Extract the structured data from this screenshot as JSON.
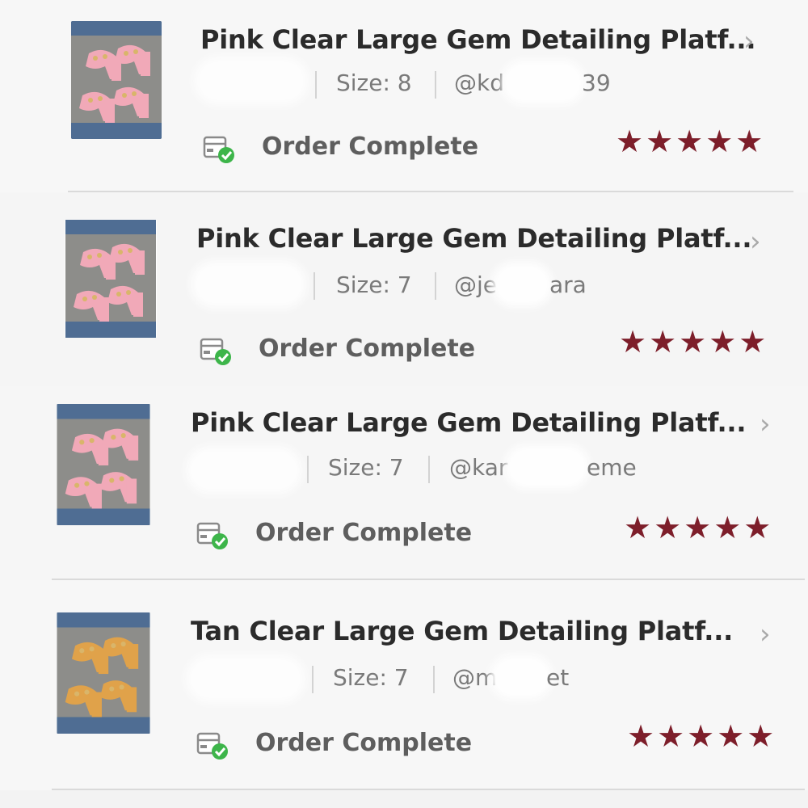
{
  "colors": {
    "star": "#7d1e2a",
    "check": "#3db54a",
    "title_text": "#2b2b2b",
    "meta_text": "#7a7a7a",
    "chevron": "#a9a9a9"
  },
  "orders": [
    {
      "title": "Pink Clear Large Gem Detailing Platf...",
      "size": "Size: 8",
      "user": "@kd",
      "user_tail": "39",
      "status": "Order Complete",
      "rating": "★★★★★",
      "rating_value": 5,
      "shoe_color": "#f1a9b8",
      "thumbnail_icon": "pink-platform-heels-photo",
      "status_icon": "package-check-icon"
    },
    {
      "title": "Pink Clear Large Gem Detailing Platf...",
      "size": "Size: 7",
      "user": "@je",
      "user_tail": "ara",
      "status": "Order Complete",
      "rating": "★★★★★",
      "rating_value": 5,
      "shoe_color": "#f1a9b8",
      "thumbnail_icon": "pink-platform-heels-photo",
      "status_icon": "package-check-icon"
    },
    {
      "title": "Pink Clear Large Gem Detailing Platf...",
      "size": "Size: 7",
      "user": "@kar",
      "user_tail": "eme",
      "status": "Order Complete",
      "rating": "★★★★★",
      "rating_value": 5,
      "shoe_color": "#f1a9b8",
      "thumbnail_icon": "pink-platform-heels-photo",
      "status_icon": "package-check-icon"
    },
    {
      "title": "Tan Clear Large Gem Detailing Platf...",
      "size": "Size: 7",
      "user": "@m",
      "user_tail": "et",
      "status": "Order Complete",
      "rating": "★★★★★",
      "rating_value": 5,
      "shoe_color": "#e0a24a",
      "thumbnail_icon": "tan-platform-heels-photo",
      "status_icon": "package-check-icon"
    }
  ]
}
